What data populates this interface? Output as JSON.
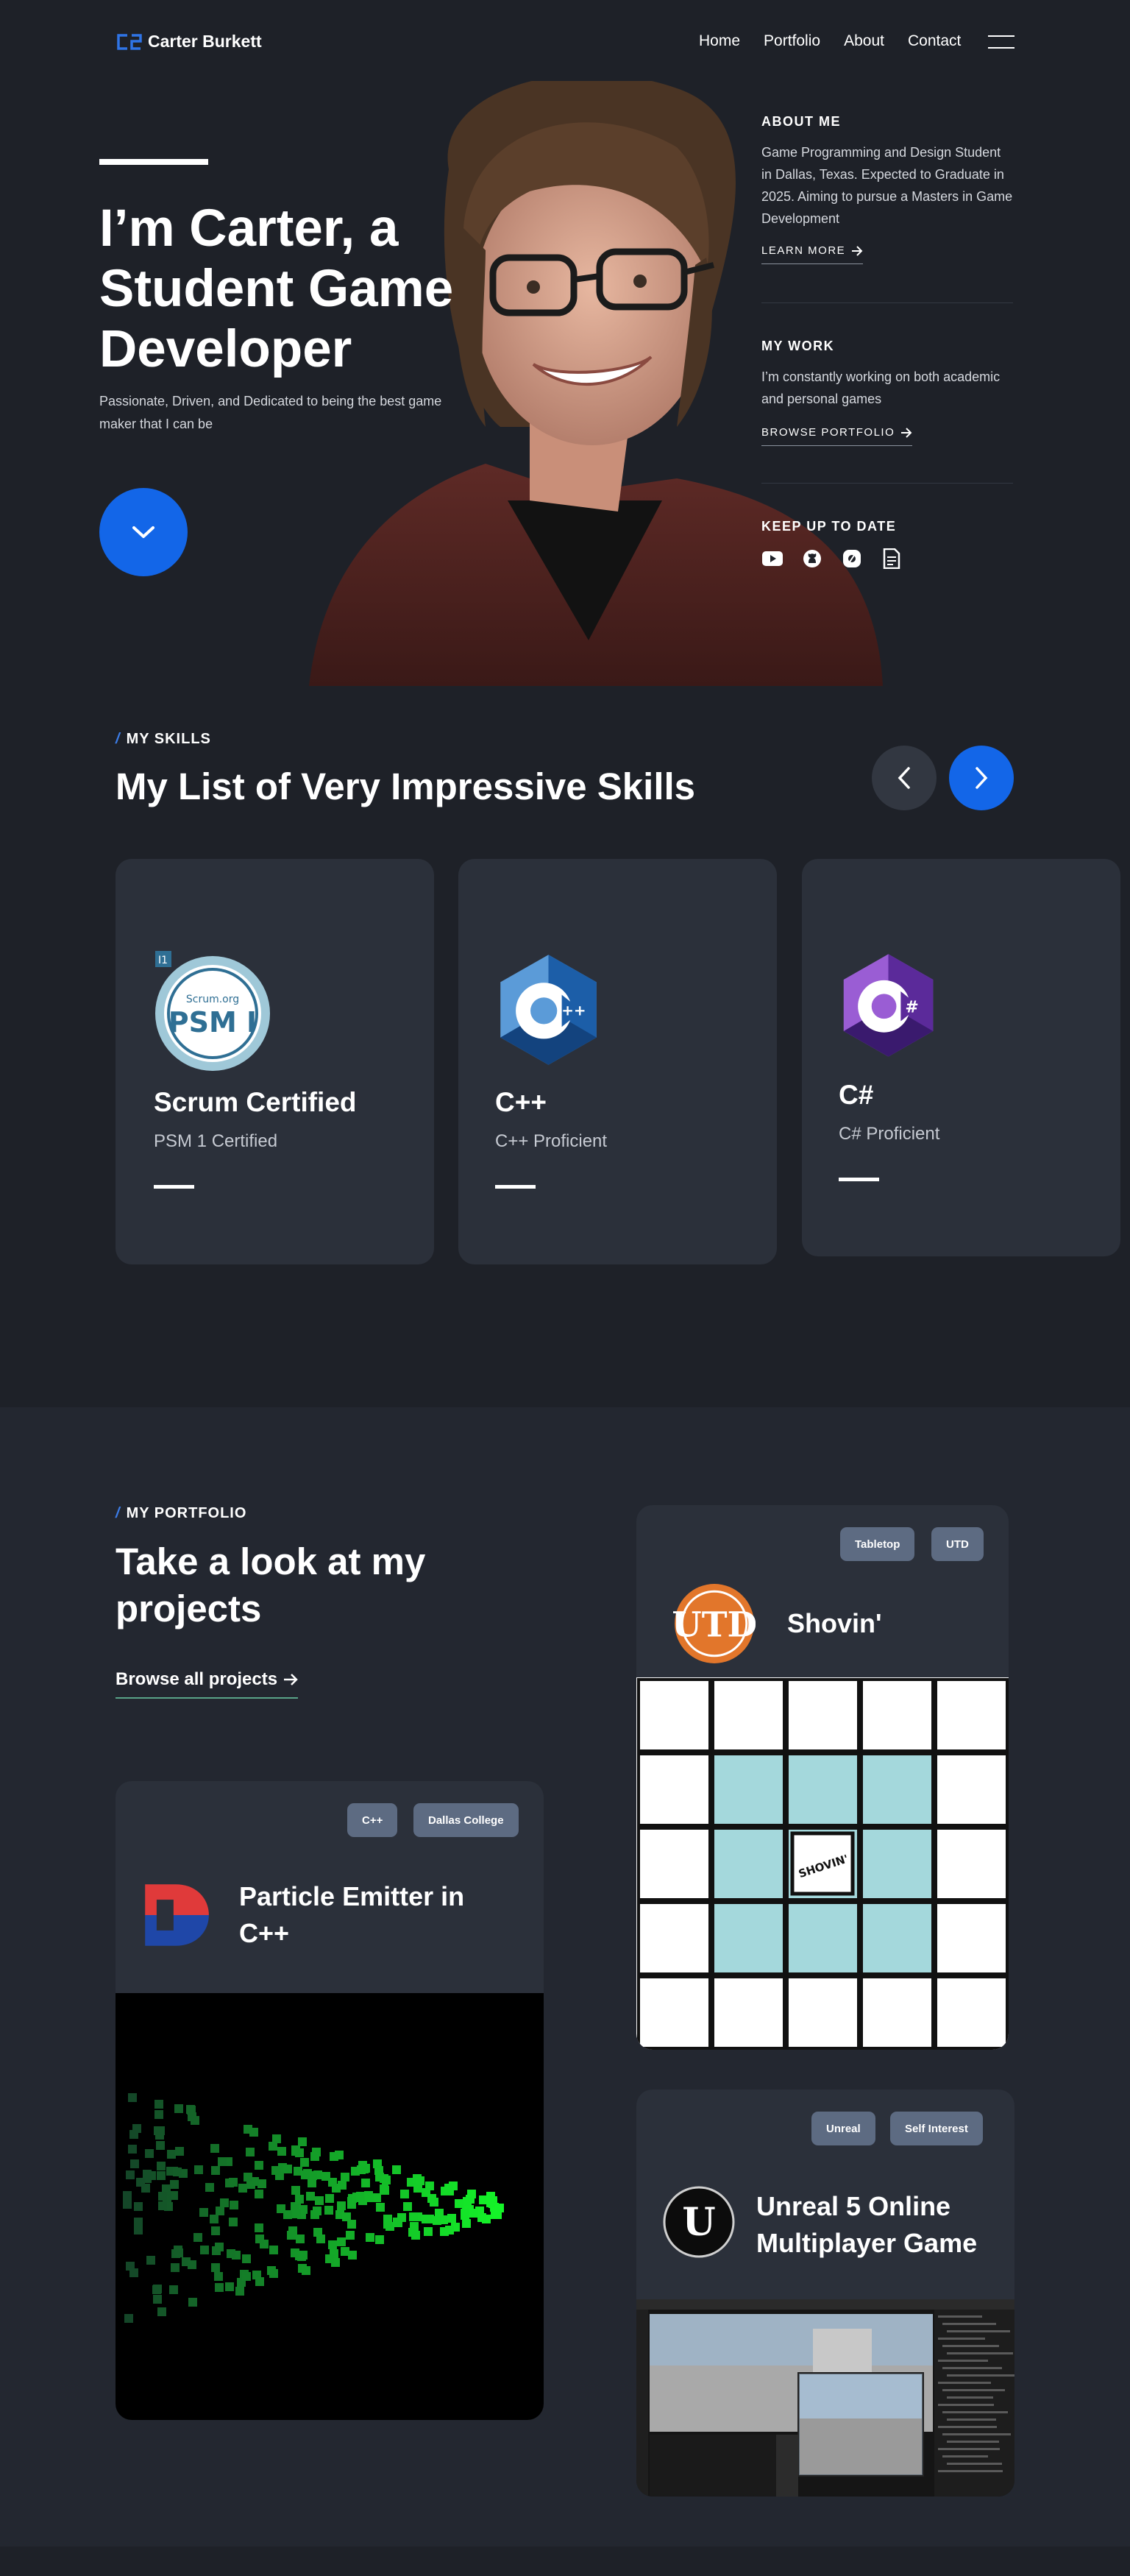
{
  "header": {
    "logo_text": "Carter Burkett",
    "nav": [
      "Home",
      "Portfolio",
      "About",
      "Contact"
    ]
  },
  "hero": {
    "title": "I’m Carter, a Student Game Developer",
    "subtitle": "Passionate, Driven, and Dedicated to being the best game maker that I can be",
    "about": {
      "heading": "ABOUT ME",
      "text": "Game Programming and Design Student in Dallas, Texas. Expected to Graduate in 2025. Aiming to pursue a Masters in Game Development",
      "link": "LEARN MORE"
    },
    "work": {
      "heading": "MY WORK",
      "text": "I’m constantly working on both academic and personal games",
      "link": "BROWSE PORTFOLIO"
    },
    "social": {
      "heading": "KEEP UP TO DATE",
      "icons": [
        "youtube-icon",
        "github-icon",
        "hashnode-icon",
        "resume-icon"
      ]
    }
  },
  "skills": {
    "eyebrow": "MY SKILLS",
    "title": "My List of Very Impressive Skills",
    "cards": [
      {
        "name": "Scrum Certified",
        "desc": "PSM 1 Certified",
        "icon": "scrum-psm-badge-icon"
      },
      {
        "name": "C++",
        "desc": "C++ Proficient",
        "icon": "cpp-logo-icon"
      },
      {
        "name": "C#",
        "desc": "C# Proficient",
        "icon": "csharp-logo-icon"
      }
    ]
  },
  "portfolio": {
    "eyebrow": "MY PORTFOLIO",
    "title": "Take a look at my projects",
    "browse": "Browse all projects",
    "projects": [
      {
        "title": "Particle Emitter in C++",
        "tags": [
          "C++",
          "Dallas College"
        ],
        "logo": "dallas-college-logo"
      },
      {
        "title": "Shovin'",
        "tags": [
          "Tabletop",
          "UTD"
        ],
        "logo": "utd-logo",
        "board_label": "SHOVIN'"
      },
      {
        "title": "Unreal 5 Online Multiplayer Game",
        "tags": [
          "Unreal",
          "Self Interest"
        ],
        "logo": "unreal-logo"
      }
    ]
  },
  "colors": {
    "background": "#1e2128",
    "card": "#2b303a",
    "accent": "#1366e8",
    "tag": "#5d6b82"
  }
}
